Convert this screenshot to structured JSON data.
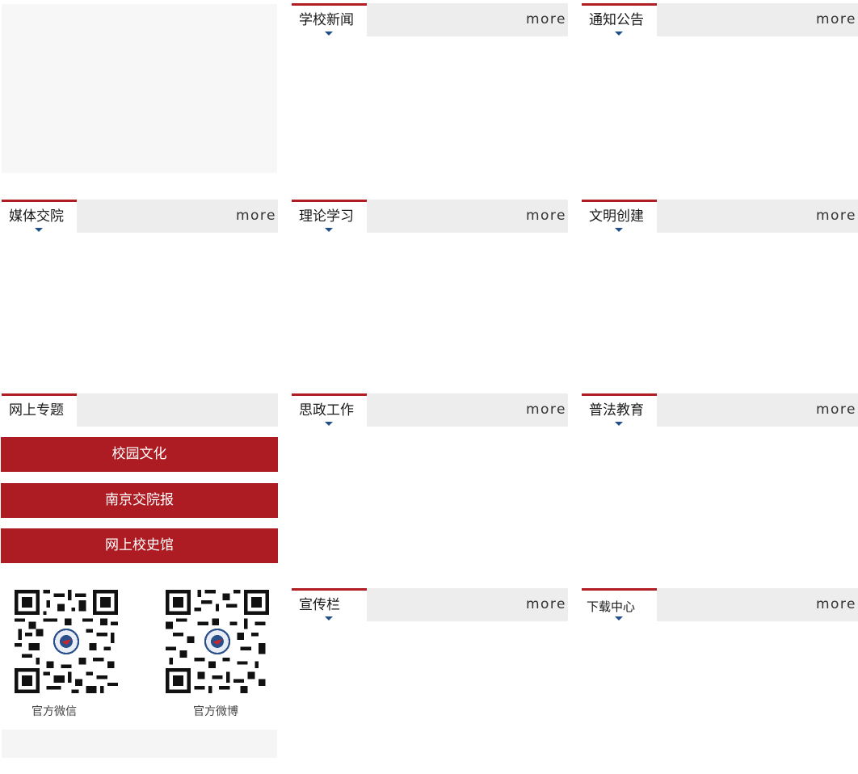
{
  "more_label": "more",
  "colors": {
    "accent_red": "#b01d23",
    "button_red": "#ad1c22",
    "caret_blue": "#1f4f86",
    "header_gray": "#ededed"
  },
  "sections": {
    "school_news": {
      "title": "学校新闻"
    },
    "notices": {
      "title": "通知公告"
    },
    "media": {
      "title": "媒体交院"
    },
    "theory": {
      "title": "理论学习"
    },
    "civilization": {
      "title": "文明创建"
    },
    "online_topics": {
      "title": "网上专题"
    },
    "ideology": {
      "title": "思政工作"
    },
    "legal": {
      "title": "普法教育"
    },
    "publicity": {
      "title": "宣传栏"
    },
    "downloads": {
      "title": "下载中心"
    }
  },
  "topic_buttons": [
    "校园文化",
    "南京交院报",
    "网上校史馆"
  ],
  "qr": {
    "wechat_label": "官方微信",
    "weibo_label": "官方微博",
    "wechat_icon": "qr-code-icon",
    "weibo_icon": "qr-code-icon"
  }
}
